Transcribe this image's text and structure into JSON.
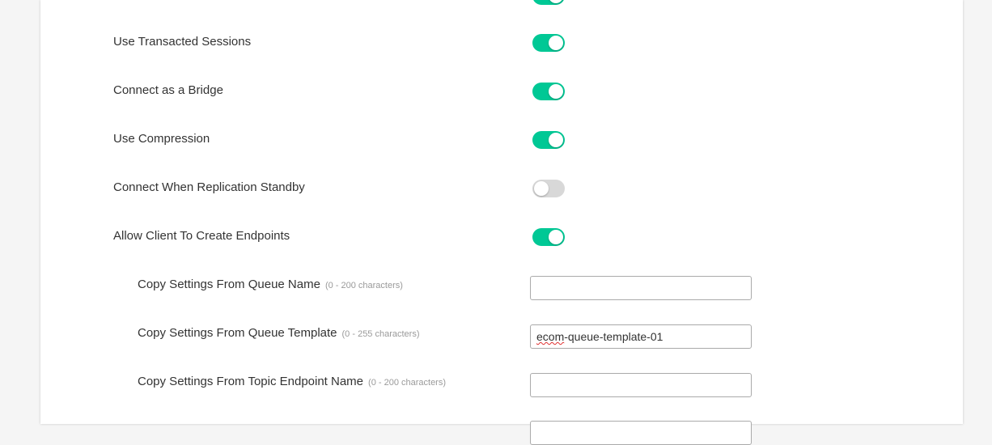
{
  "settings": [
    {
      "label": "Use Transacted Sessions",
      "enabled": true
    },
    {
      "label": "Connect as a Bridge",
      "enabled": true
    },
    {
      "label": "Use Compression",
      "enabled": true
    },
    {
      "label": "Connect When Replication Standby",
      "enabled": false
    },
    {
      "label": "Allow Client To Create Endpoints",
      "enabled": true
    }
  ],
  "endpoint_fields": [
    {
      "label": "Copy Settings From Queue Name",
      "hint": "(0 - 200 characters)",
      "value": ""
    },
    {
      "label": "Copy Settings From Queue Template",
      "hint": "(0 - 255 characters)",
      "value_prefix": "ecom",
      "value_suffix": "-queue-template-01"
    },
    {
      "label": "Copy Settings From Topic Endpoint Name",
      "hint": "(0 - 200 characters)",
      "value": ""
    }
  ],
  "colors": {
    "toggle_on": "#00c895",
    "toggle_off": "#d8d8d8"
  }
}
